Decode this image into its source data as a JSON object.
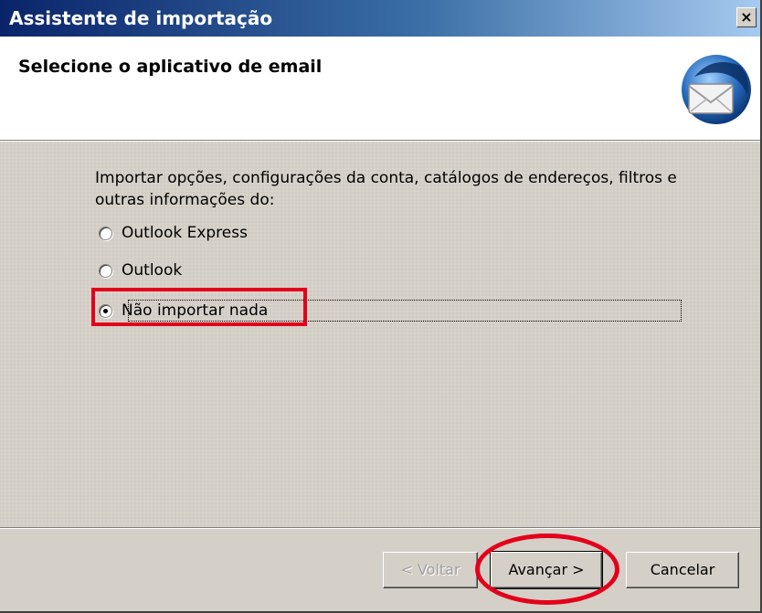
{
  "window": {
    "title": "Assistente de importação",
    "close_glyph": "✕"
  },
  "header": {
    "title": "Selecione o aplicativo de email",
    "logo_icon": "thunderbird-icon"
  },
  "body": {
    "intro": "Importar opções, configurações da conta, catálogos de endereços, filtros e outras informações do:",
    "options": [
      {
        "label": "Outlook Express",
        "checked": false
      },
      {
        "label": "Outlook",
        "checked": false
      },
      {
        "label": "Não importar nada",
        "checked": true
      }
    ]
  },
  "buttons": {
    "back_label": "< Voltar",
    "next_label": "Avançar >",
    "cancel_label": "Cancelar"
  },
  "colors": {
    "highlight": "#e4001b",
    "titlebar_start": "#0a246a",
    "face": "#d4d0c8"
  }
}
